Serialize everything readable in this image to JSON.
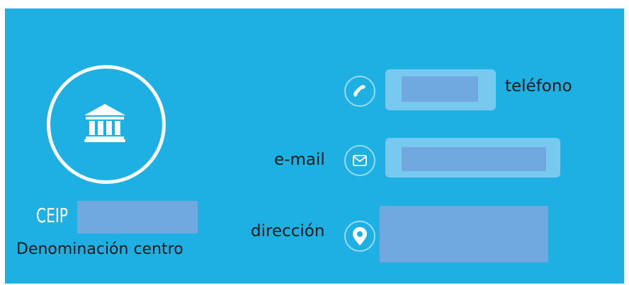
{
  "profile": {
    "prefix": "CEIP",
    "caption": "Denominación centro",
    "icon": "institution-icon"
  },
  "contact": {
    "phone_label": "teléfono",
    "phone_icon": "phone-icon",
    "email_label": "e-mail",
    "email_icon": "envelope-icon",
    "address_label": "dirección",
    "address_icon": "map-pin-icon"
  },
  "colors": {
    "background": "#1eb0e2",
    "field": "#78c9ef",
    "redaction": "#70a9e0"
  }
}
